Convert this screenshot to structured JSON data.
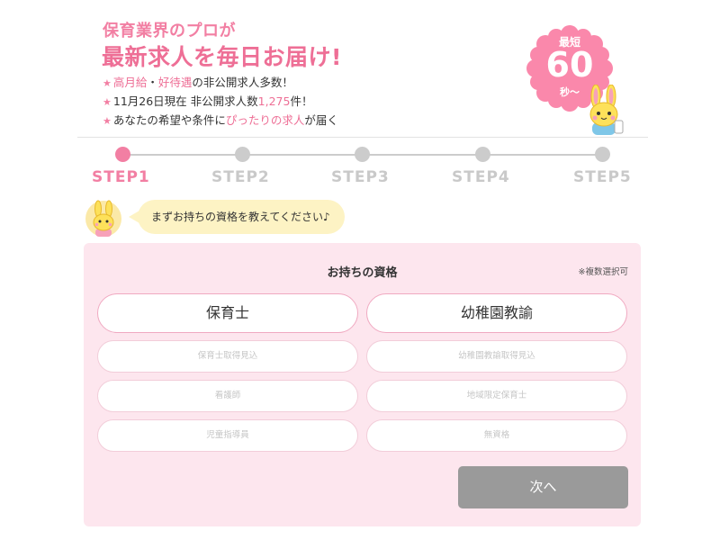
{
  "header": {
    "tagline": "保育業界のプロが",
    "headline": "最新求人を毎日お届け!",
    "bullets": [
      {
        "star": "★",
        "parts": [
          {
            "text": "高月給",
            "pink": true
          },
          {
            "text": "・",
            "pink": false
          },
          {
            "text": "好待遇",
            "pink": true
          },
          {
            "text": "の非公開求人多数！",
            "pink": false
          }
        ]
      },
      {
        "star": "★",
        "parts": [
          {
            "text": "11月26日現在 非公開求人数",
            "pink": false
          },
          {
            "text": "1,275",
            "pink": true
          },
          {
            "text": "件！",
            "pink": false
          }
        ]
      },
      {
        "star": "★",
        "parts": [
          {
            "text": "あなたの希望や条件に",
            "pink": false
          },
          {
            "text": "ぴったりの求人",
            "pink": true
          },
          {
            "text": "が届く",
            "pink": false
          }
        ]
      }
    ],
    "badge": {
      "top": "最短",
      "number": "60",
      "bottom": "秒〜"
    }
  },
  "steps": {
    "items": [
      "STEP1",
      "STEP2",
      "STEP3",
      "STEP4",
      "STEP5"
    ],
    "active_index": 0
  },
  "speech": {
    "text": "まずお持ちの資格を教えてください♪"
  },
  "form": {
    "title": "お持ちの資格",
    "note": "※複数選択可",
    "main_options": [
      "保育士",
      "幼稚園教諭"
    ],
    "sub_options": [
      "保育士取得見込",
      "幼稚園教諭取得見込",
      "看護師",
      "地域限定保育士",
      "児童指導員",
      "無資格"
    ],
    "next_label": "次へ"
  },
  "colors": {
    "accent_pink": "#ee6f96",
    "panel_bg": "#fde6ee",
    "speech_bg": "#fdf3c4",
    "button_disabled": "#9a9a9a",
    "step_inactive": "#cccccc"
  },
  "icons": [
    "star-icon",
    "rabbit-mascot-icon",
    "step-dot-icon"
  ]
}
